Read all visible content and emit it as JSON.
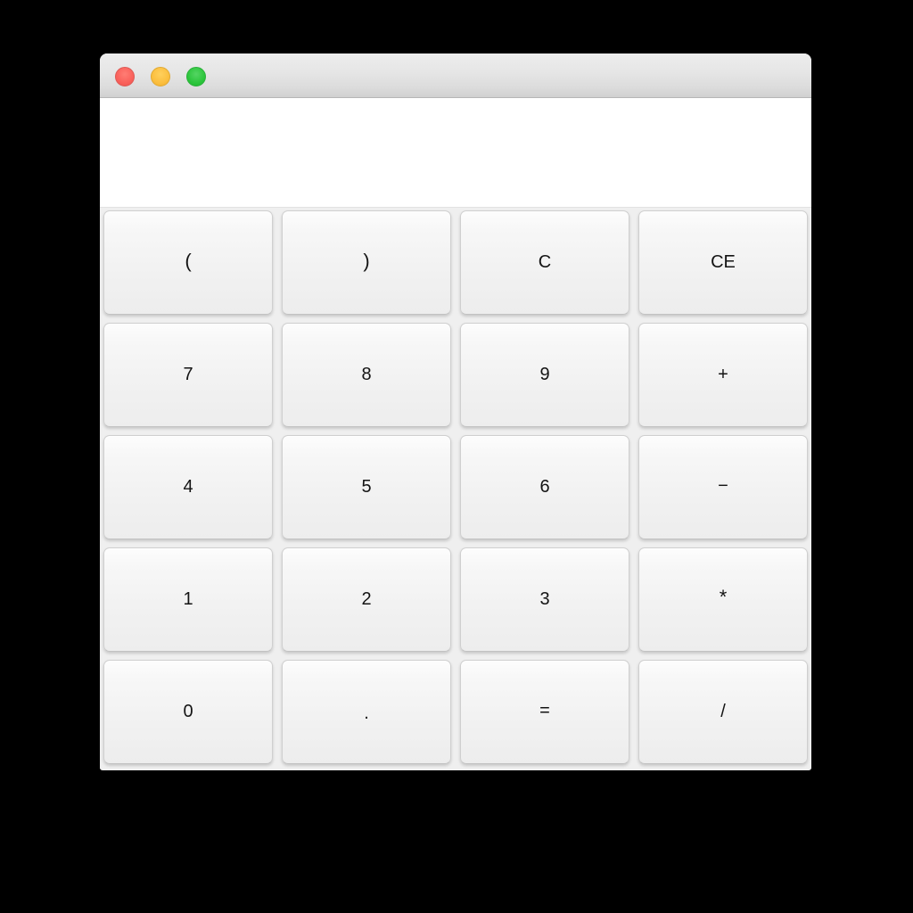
{
  "window": {
    "title": "",
    "traffic_lights": [
      {
        "name": "close",
        "color": "#f9605a"
      },
      {
        "name": "minimize",
        "color": "#fbbe3e"
      },
      {
        "name": "maximize",
        "color": "#2bc53b"
      }
    ]
  },
  "display": {
    "value": "",
    "placeholder": ""
  },
  "keypad": {
    "rows": [
      [
        {
          "label": "(",
          "name": "key-open-paren",
          "kind": "paren"
        },
        {
          "label": ")",
          "name": "key-close-paren",
          "kind": "paren"
        },
        {
          "label": "C",
          "name": "key-clear",
          "kind": "clear"
        },
        {
          "label": "CE",
          "name": "key-clear-entry",
          "kind": "clear"
        }
      ],
      [
        {
          "label": "7",
          "name": "key-7",
          "kind": "digit"
        },
        {
          "label": "8",
          "name": "key-8",
          "kind": "digit"
        },
        {
          "label": "9",
          "name": "key-9",
          "kind": "digit"
        },
        {
          "label": "+",
          "name": "key-plus",
          "kind": "op-plus"
        }
      ],
      [
        {
          "label": "4",
          "name": "key-4",
          "kind": "digit"
        },
        {
          "label": "5",
          "name": "key-5",
          "kind": "digit"
        },
        {
          "label": "6",
          "name": "key-6",
          "kind": "digit"
        },
        {
          "label": "−",
          "name": "key-minus",
          "kind": "op-minus"
        }
      ],
      [
        {
          "label": "1",
          "name": "key-1",
          "kind": "digit"
        },
        {
          "label": "2",
          "name": "key-2",
          "kind": "digit"
        },
        {
          "label": "3",
          "name": "key-3",
          "kind": "digit"
        },
        {
          "label": "*",
          "name": "key-multiply",
          "kind": "op-asterisk"
        }
      ],
      [
        {
          "label": "0",
          "name": "key-0",
          "kind": "digit"
        },
        {
          "label": ".",
          "name": "key-decimal",
          "kind": "dot"
        },
        {
          "label": "=",
          "name": "key-equals",
          "kind": "op-equals"
        },
        {
          "label": "/",
          "name": "key-divide",
          "kind": "op-divide"
        }
      ]
    ]
  },
  "colors": {
    "desktop_background": "#000000",
    "window_background": "#efefef",
    "titlebar_top": "#ededed",
    "titlebar_bottom": "#d0d0d0",
    "display_background": "#ffffff",
    "key_face": "#f1f1f1",
    "key_border": "#cfcfcf",
    "key_text": "#141414"
  }
}
